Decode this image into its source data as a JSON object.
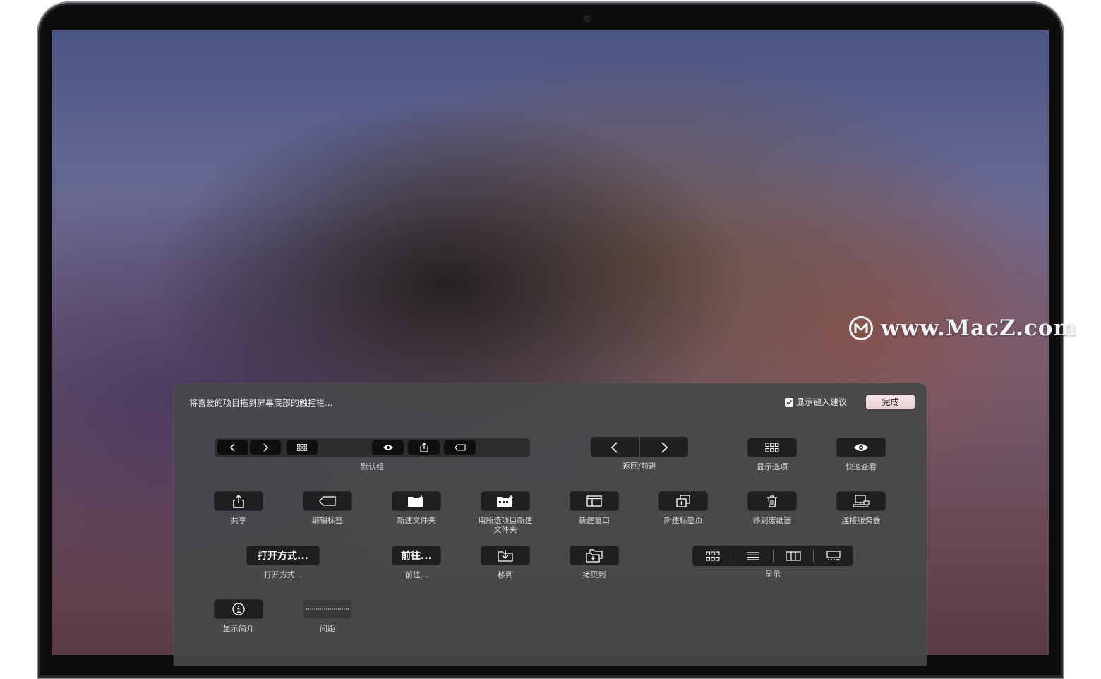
{
  "watermark": {
    "text": "www.MacZ.com"
  },
  "panel": {
    "prompt": "将喜爱的项目拖到屏幕底部的触控栏...",
    "show_typing_suggestions": {
      "label": "显示键入建议",
      "checked": true
    },
    "done_label": "完成",
    "default_group_label": "默认组",
    "back_forward_label": "返回/前进",
    "items": {
      "view_options": "显示选项",
      "quick_look": "快速查看",
      "share": "共享",
      "edit_tags": "编辑标签",
      "new_folder": "新建文件夹",
      "new_folder_with_selection": "用所选项目新建文件夹",
      "new_window": "新建窗口",
      "new_tab": "新建标签页",
      "move_to_trash": "移到废纸篓",
      "connect_server": "连接服务器",
      "open_with": "打开方式...",
      "open_with_button": "打开方式...",
      "go_to": "前往...",
      "go_to_button": "前往...",
      "move_to": "移到",
      "copy_to": "拷贝到",
      "view": "显示",
      "get_info": "显示简介",
      "spacing": "间距"
    }
  }
}
